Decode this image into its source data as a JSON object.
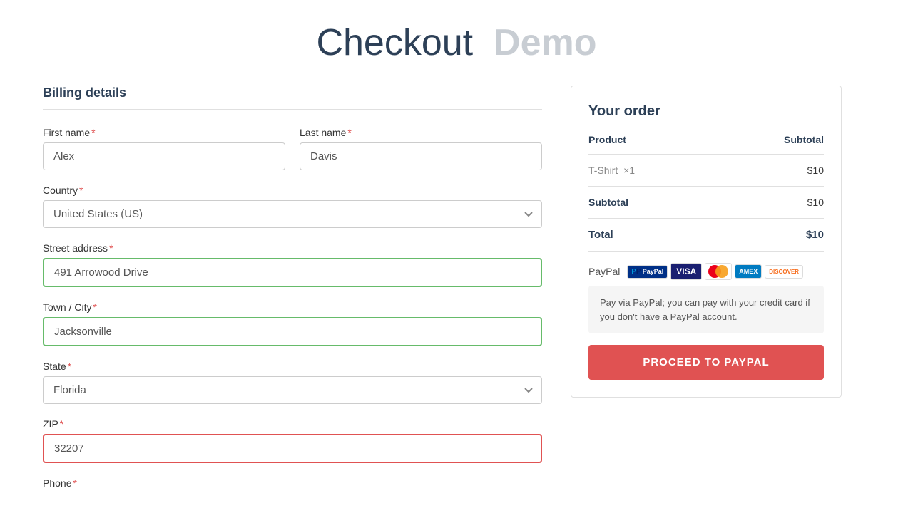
{
  "page": {
    "title": "Checkout",
    "title_demo": "Demo"
  },
  "billing": {
    "section_title": "Billing details",
    "first_name_label": "First name",
    "last_name_label": "Last name",
    "country_label": "Country",
    "street_label": "Street address",
    "city_label": "Town / City",
    "state_label": "State",
    "zip_label": "ZIP",
    "phone_label": "Phone",
    "first_name_value": "Alex",
    "last_name_value": "Davis",
    "country_value": "United States (US)",
    "street_value": "491 Arrowood Drive",
    "city_value": "Jacksonville",
    "state_value": "Florida",
    "zip_value": "32207"
  },
  "order": {
    "title": "Your order",
    "col_product": "Product",
    "col_subtotal": "Subtotal",
    "product_name": "T-Shirt",
    "product_qty": "×1",
    "product_price": "$10",
    "subtotal_label": "Subtotal",
    "subtotal_value": "$10",
    "total_label": "Total",
    "total_value": "$10",
    "payment_label": "PayPal",
    "payment_info": "Pay via PayPal; you can pay with your credit card if you don't have a PayPal account.",
    "proceed_button": "PROCEED TO PAYPAL"
  }
}
